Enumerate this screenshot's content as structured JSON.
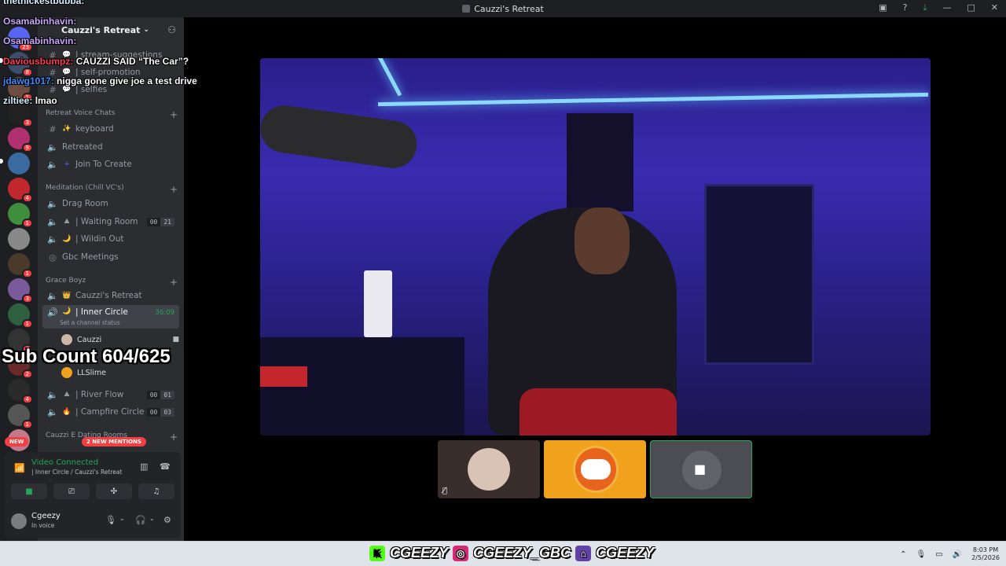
{
  "window": {
    "title": "Cauzzi's Retreat"
  },
  "server": {
    "name": "Cauzzi's Retreat"
  },
  "channels_top": [
    {
      "label": "| stream-suggestions"
    },
    {
      "label": "| self-promotion"
    },
    {
      "label": "| selfies"
    }
  ],
  "categories": {
    "voice_chats": "Retreat Voice Chats",
    "meditation": "Meditation (Chill VC's)",
    "grace": "Grace Boyz",
    "dating": "Cauzzi E Dating Rooms"
  },
  "voice_channels": {
    "keyboard": "keyboard",
    "retreated": "Retreated",
    "join_create": "Join To Create",
    "drag_room": "Drag Room",
    "waiting_room": "| Waiting Room",
    "waiting_counts": [
      "00",
      "21"
    ],
    "wildin_out": "| Wildin Out",
    "gbc_meetings": "Gbc Meetings",
    "cauzzis_retreat": "Cauzzi's Retreat",
    "inner_circle": "| Inner Circle",
    "inner_circle_time": "36:09",
    "inner_circle_status": "Set a channel status",
    "river_flow": "| River Flow",
    "river_counts": [
      "00",
      "01"
    ],
    "campfire": "| Campfire Circle",
    "campfire_counts": [
      "00",
      "03"
    ]
  },
  "members": [
    "Cauzzi",
    "LLSlime"
  ],
  "badges": {
    "new": "NEW",
    "mentions": "2 NEW MENTIONS"
  },
  "voice_panel": {
    "title": "Video Connected",
    "subtitle": "| Inner Circle / Cauzzi's Retreat"
  },
  "user": {
    "name": "Cgeezy",
    "status": "In voice"
  },
  "overlay_chat": [
    {
      "name": "thethickestbubba:",
      "msg": ""
    },
    {
      "name": "Osamabinhavin:",
      "msg": ""
    },
    {
      "name": "Osamabinhavin:",
      "msg": ""
    },
    {
      "name": "Daviousbumpz:",
      "msg": "CAUZZI SAID “The Car”?"
    },
    {
      "name": "jdawg1017:",
      "msg": "nigga gone give joe a test drive"
    },
    {
      "name": "ziltiee:",
      "msg": "lmao"
    }
  ],
  "sub_count": "Sub Count 604/625",
  "social_handles": [
    "CGEEZY",
    "CGEEZY_GBC",
    "CGEEZY"
  ],
  "taskbar": {
    "time": "8:03 PM",
    "date": "2/5/2026"
  },
  "colors": {
    "accent_green": "#23a55a",
    "mention_red": "#f23f43",
    "sidebar_bg": "#2b2d31"
  }
}
